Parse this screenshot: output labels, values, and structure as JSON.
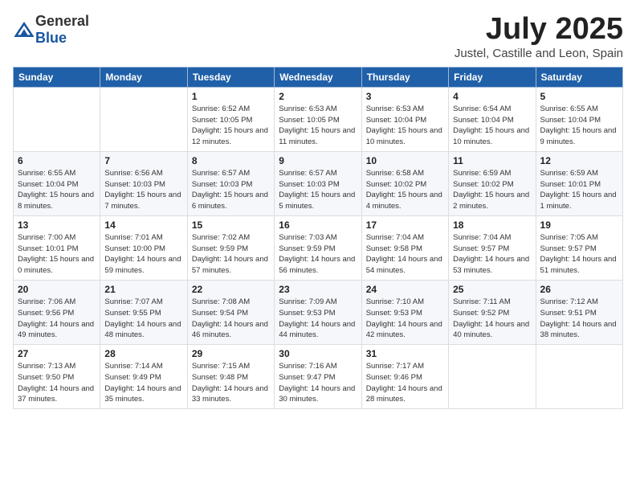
{
  "header": {
    "logo_general": "General",
    "logo_blue": "Blue",
    "month_title": "July 2025",
    "location": "Justel, Castille and Leon, Spain"
  },
  "weekdays": [
    "Sunday",
    "Monday",
    "Tuesday",
    "Wednesday",
    "Thursday",
    "Friday",
    "Saturday"
  ],
  "weeks": [
    [
      {
        "day": "",
        "sunrise": "",
        "sunset": "",
        "daylight": ""
      },
      {
        "day": "",
        "sunrise": "",
        "sunset": "",
        "daylight": ""
      },
      {
        "day": "1",
        "sunrise": "Sunrise: 6:52 AM",
        "sunset": "Sunset: 10:05 PM",
        "daylight": "Daylight: 15 hours and 12 minutes."
      },
      {
        "day": "2",
        "sunrise": "Sunrise: 6:53 AM",
        "sunset": "Sunset: 10:05 PM",
        "daylight": "Daylight: 15 hours and 11 minutes."
      },
      {
        "day": "3",
        "sunrise": "Sunrise: 6:53 AM",
        "sunset": "Sunset: 10:04 PM",
        "daylight": "Daylight: 15 hours and 10 minutes."
      },
      {
        "day": "4",
        "sunrise": "Sunrise: 6:54 AM",
        "sunset": "Sunset: 10:04 PM",
        "daylight": "Daylight: 15 hours and 10 minutes."
      },
      {
        "day": "5",
        "sunrise": "Sunrise: 6:55 AM",
        "sunset": "Sunset: 10:04 PM",
        "daylight": "Daylight: 15 hours and 9 minutes."
      }
    ],
    [
      {
        "day": "6",
        "sunrise": "Sunrise: 6:55 AM",
        "sunset": "Sunset: 10:04 PM",
        "daylight": "Daylight: 15 hours and 8 minutes."
      },
      {
        "day": "7",
        "sunrise": "Sunrise: 6:56 AM",
        "sunset": "Sunset: 10:03 PM",
        "daylight": "Daylight: 15 hours and 7 minutes."
      },
      {
        "day": "8",
        "sunrise": "Sunrise: 6:57 AM",
        "sunset": "Sunset: 10:03 PM",
        "daylight": "Daylight: 15 hours and 6 minutes."
      },
      {
        "day": "9",
        "sunrise": "Sunrise: 6:57 AM",
        "sunset": "Sunset: 10:03 PM",
        "daylight": "Daylight: 15 hours and 5 minutes."
      },
      {
        "day": "10",
        "sunrise": "Sunrise: 6:58 AM",
        "sunset": "Sunset: 10:02 PM",
        "daylight": "Daylight: 15 hours and 4 minutes."
      },
      {
        "day": "11",
        "sunrise": "Sunrise: 6:59 AM",
        "sunset": "Sunset: 10:02 PM",
        "daylight": "Daylight: 15 hours and 2 minutes."
      },
      {
        "day": "12",
        "sunrise": "Sunrise: 6:59 AM",
        "sunset": "Sunset: 10:01 PM",
        "daylight": "Daylight: 15 hours and 1 minute."
      }
    ],
    [
      {
        "day": "13",
        "sunrise": "Sunrise: 7:00 AM",
        "sunset": "Sunset: 10:01 PM",
        "daylight": "Daylight: 15 hours and 0 minutes."
      },
      {
        "day": "14",
        "sunrise": "Sunrise: 7:01 AM",
        "sunset": "Sunset: 10:00 PM",
        "daylight": "Daylight: 14 hours and 59 minutes."
      },
      {
        "day": "15",
        "sunrise": "Sunrise: 7:02 AM",
        "sunset": "Sunset: 9:59 PM",
        "daylight": "Daylight: 14 hours and 57 minutes."
      },
      {
        "day": "16",
        "sunrise": "Sunrise: 7:03 AM",
        "sunset": "Sunset: 9:59 PM",
        "daylight": "Daylight: 14 hours and 56 minutes."
      },
      {
        "day": "17",
        "sunrise": "Sunrise: 7:04 AM",
        "sunset": "Sunset: 9:58 PM",
        "daylight": "Daylight: 14 hours and 54 minutes."
      },
      {
        "day": "18",
        "sunrise": "Sunrise: 7:04 AM",
        "sunset": "Sunset: 9:57 PM",
        "daylight": "Daylight: 14 hours and 53 minutes."
      },
      {
        "day": "19",
        "sunrise": "Sunrise: 7:05 AM",
        "sunset": "Sunset: 9:57 PM",
        "daylight": "Daylight: 14 hours and 51 minutes."
      }
    ],
    [
      {
        "day": "20",
        "sunrise": "Sunrise: 7:06 AM",
        "sunset": "Sunset: 9:56 PM",
        "daylight": "Daylight: 14 hours and 49 minutes."
      },
      {
        "day": "21",
        "sunrise": "Sunrise: 7:07 AM",
        "sunset": "Sunset: 9:55 PM",
        "daylight": "Daylight: 14 hours and 48 minutes."
      },
      {
        "day": "22",
        "sunrise": "Sunrise: 7:08 AM",
        "sunset": "Sunset: 9:54 PM",
        "daylight": "Daylight: 14 hours and 46 minutes."
      },
      {
        "day": "23",
        "sunrise": "Sunrise: 7:09 AM",
        "sunset": "Sunset: 9:53 PM",
        "daylight": "Daylight: 14 hours and 44 minutes."
      },
      {
        "day": "24",
        "sunrise": "Sunrise: 7:10 AM",
        "sunset": "Sunset: 9:53 PM",
        "daylight": "Daylight: 14 hours and 42 minutes."
      },
      {
        "day": "25",
        "sunrise": "Sunrise: 7:11 AM",
        "sunset": "Sunset: 9:52 PM",
        "daylight": "Daylight: 14 hours and 40 minutes."
      },
      {
        "day": "26",
        "sunrise": "Sunrise: 7:12 AM",
        "sunset": "Sunset: 9:51 PM",
        "daylight": "Daylight: 14 hours and 38 minutes."
      }
    ],
    [
      {
        "day": "27",
        "sunrise": "Sunrise: 7:13 AM",
        "sunset": "Sunset: 9:50 PM",
        "daylight": "Daylight: 14 hours and 37 minutes."
      },
      {
        "day": "28",
        "sunrise": "Sunrise: 7:14 AM",
        "sunset": "Sunset: 9:49 PM",
        "daylight": "Daylight: 14 hours and 35 minutes."
      },
      {
        "day": "29",
        "sunrise": "Sunrise: 7:15 AM",
        "sunset": "Sunset: 9:48 PM",
        "daylight": "Daylight: 14 hours and 33 minutes."
      },
      {
        "day": "30",
        "sunrise": "Sunrise: 7:16 AM",
        "sunset": "Sunset: 9:47 PM",
        "daylight": "Daylight: 14 hours and 30 minutes."
      },
      {
        "day": "31",
        "sunrise": "Sunrise: 7:17 AM",
        "sunset": "Sunset: 9:46 PM",
        "daylight": "Daylight: 14 hours and 28 minutes."
      },
      {
        "day": "",
        "sunrise": "",
        "sunset": "",
        "daylight": ""
      },
      {
        "day": "",
        "sunrise": "",
        "sunset": "",
        "daylight": ""
      }
    ]
  ]
}
